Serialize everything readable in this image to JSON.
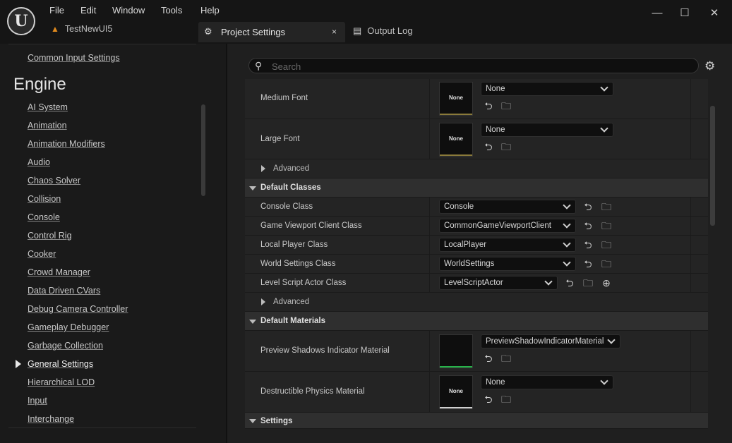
{
  "menu": [
    "File",
    "Edit",
    "Window",
    "Tools",
    "Help"
  ],
  "project_tab": {
    "label": "TestNewUI5"
  },
  "tabs": [
    {
      "label": "Project Settings",
      "close": "×"
    },
    {
      "label": "Output Log"
    }
  ],
  "window_controls": {
    "minimize": "—",
    "maximize": "☐",
    "close": "✕"
  },
  "sidebar": {
    "top_item": "Common Input Settings",
    "section": "Engine",
    "items": [
      "AI System",
      "Animation",
      "Animation Modifiers",
      "Audio",
      "Chaos Solver",
      "Collision",
      "Console",
      "Control Rig",
      "Cooker",
      "Crowd Manager",
      "Data Driven CVars",
      "Debug Camera Controller",
      "Gameplay Debugger",
      "Garbage Collection",
      "General Settings",
      "Hierarchical LOD",
      "Input",
      "Interchange"
    ],
    "selected": "General Settings"
  },
  "search": {
    "placeholder": "Search"
  },
  "details": {
    "medium_font": {
      "label": "Medium Font",
      "thumb": "None",
      "value": "None"
    },
    "large_font": {
      "label": "Large Font",
      "thumb": "None",
      "value": "None"
    },
    "advanced_1": "Advanced",
    "default_classes": "Default Classes",
    "console_class": {
      "label": "Console Class",
      "value": "Console"
    },
    "viewport_class": {
      "label": "Game Viewport Client Class",
      "value": "CommonGameViewportClient"
    },
    "local_player": {
      "label": "Local Player Class",
      "value": "LocalPlayer"
    },
    "world_settings": {
      "label": "World Settings Class",
      "value": "WorldSettings"
    },
    "level_script": {
      "label": "Level Script Actor Class",
      "value": "LevelScriptActor"
    },
    "advanced_2": "Advanced",
    "default_materials": "Default Materials",
    "preview_shadows": {
      "label": "Preview Shadows Indicator Material",
      "value": "PreviewShadowIndicatorMaterial"
    },
    "destructible": {
      "label": "Destructible Physics Material",
      "thumb": "None",
      "value": "None"
    },
    "settings": "Settings"
  }
}
